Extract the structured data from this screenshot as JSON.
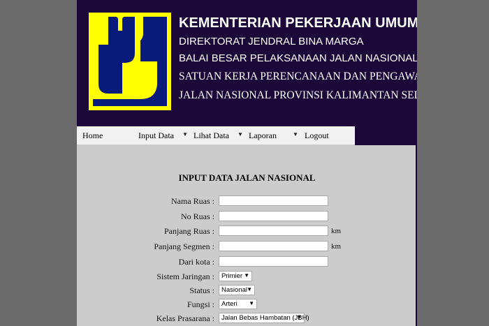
{
  "header": {
    "line1": "KEMENTERIAN PEKERJAAN UMUM",
    "line2": "DIREKTORAT JENDRAL BINA MARGA",
    "line3": "BALAI BESAR PELAKSANAAN JALAN NASIONAL VII",
    "line4": "SATUAN KERJA PERENCANAAN DAN PENGAWASAN",
    "line5": "JALAN NASIONAL PROVINSI KALIMANTAN SELATAN",
    "logo_colors": {
      "background": "#ffff00",
      "shape": "#0a1a7a"
    }
  },
  "nav": {
    "home": "Home",
    "input_data": "Input Data",
    "lihat_data": "Lihat Data",
    "laporan": "Laporan",
    "logout": "Logout",
    "arrow": "▼"
  },
  "form": {
    "title": "INPUT DATA JALAN NASIONAL",
    "nama_ruas_label": "Nama Ruas :",
    "nama_ruas_value": "",
    "no_ruas_label": "No Ruas :",
    "no_ruas_value": "",
    "panjang_ruas_label": "Panjang Ruas :",
    "panjang_ruas_value": "",
    "panjang_ruas_unit": "km",
    "panjang_segmen_label": "Panjang Segmen :",
    "panjang_segmen_value": "",
    "panjang_segmen_unit": "km",
    "dari_kota_label": "Dari kota :",
    "dari_kota_value": "",
    "sistem_jaringan_label": "Sistem Jaringan :",
    "sistem_jaringan_value": "Primier",
    "status_label": "Status :",
    "status_value": "Nasional",
    "fungsi_label": "Fungsi :",
    "fungsi_value": "Arteri",
    "kelas_prasarana_label": "Kelas Prasarana :",
    "kelas_prasarana_value": "Jalan Bebas Hambatan (JBH)"
  }
}
